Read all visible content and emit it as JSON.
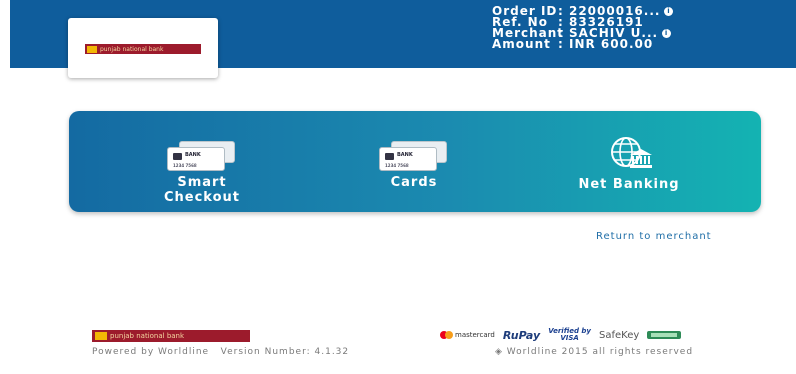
{
  "header": {
    "order": [
      {
        "key": "Order ID",
        "value": ": 22000016...",
        "icon": "info-icon"
      },
      {
        "key": "Ref. No",
        "value": ": 83326191",
        "icon": null
      },
      {
        "key": "Merchant",
        "value": ": SACHIV U...",
        "icon": "info-icon"
      },
      {
        "key": "Amount",
        "value": ": INR 600.00",
        "icon": null
      }
    ],
    "info_glyph": "i",
    "bank_logo_text": "punjab national bank"
  },
  "payment_options": [
    {
      "label_line1": "Smart",
      "label_line2": "Checkout",
      "icon": "card-icon"
    },
    {
      "label_line1": "Cards",
      "label_line2": "",
      "icon": "card-icon"
    },
    {
      "label_line1": "Net Banking",
      "label_line2": "",
      "icon": "globe-bank-icon"
    }
  ],
  "card_icon": {
    "bank": "BANK",
    "number": "1234 7568"
  },
  "return_link": "Return to merchant",
  "footer": {
    "bank_logo_text": "punjab national bank",
    "powered_by": "Powered by Worldline",
    "version": "Version Number: 4.1.32",
    "badges": {
      "mastercard": "mastercard",
      "rupay": "RuPay",
      "visa_line1": "Verified by",
      "visa_line2": "VISA",
      "safekey": "SafeKey"
    },
    "copyright": "◈ Worldline 2015 all rights reserved"
  },
  "colors": {
    "header_bg": "#0f5d9c",
    "panel_start": "#146aa2",
    "panel_end": "#14b3b2",
    "logo_red": "#9c1b2c",
    "link": "#1f6ea7"
  }
}
